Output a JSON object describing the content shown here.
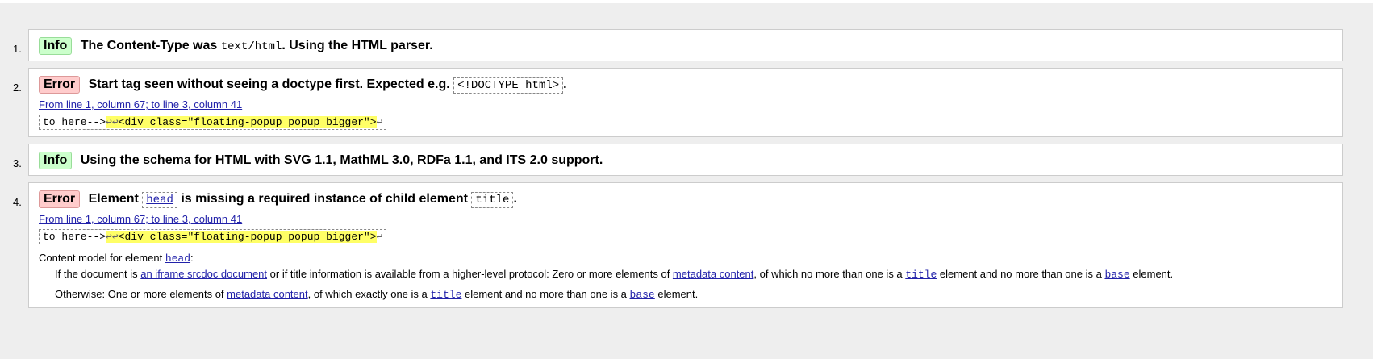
{
  "messages": [
    {
      "num": "1.",
      "badge": "Info",
      "text_before": "The Content-Type was ",
      "code": "text/html",
      "text_after": ". Using the HTML parser."
    },
    {
      "num": "2.",
      "badge": "Error",
      "text_before": "Start tag seen without seeing a doctype first. Expected e.g. ",
      "code": "<!DOCTYPE html>",
      "text_after": ".",
      "location": "From line 1, column 67; to line 3, column 41",
      "extract_pre": "to here-->",
      "extract_lf1": "↩↩",
      "extract_hl": "<div class=\"floating-popup popup bigger\">",
      "extract_lf2": "↩"
    },
    {
      "num": "3.",
      "badge": "Info",
      "text": "Using the schema for HTML with SVG 1.1, MathML 3.0, RDFa 1.1, and ITS 2.0 support."
    },
    {
      "num": "4.",
      "badge": "Error",
      "text_before": "Element ",
      "code1": "head",
      "text_mid": " is missing a required instance of child element ",
      "code2": "title",
      "text_after": ".",
      "location": "From line 1, column 67; to line 3, column 41",
      "extract_pre": "to here-->",
      "extract_lf1": "↩↩",
      "extract_hl": "<div class=\"floating-popup popup bigger\">",
      "extract_lf2": "↩",
      "content_model_label": "Content model for element ",
      "content_model_code": "head",
      "content_model_colon": ":",
      "line1_a": "If the document is ",
      "line1_link": "an iframe srcdoc document",
      "line1_b": " or if title information is available from a higher-level protocol: Zero or more elements of ",
      "line1_link2": "metadata content",
      "line1_c": ", of which no more than one is a ",
      "line1_code1": "title",
      "line1_d": " element and no more than one is a ",
      "line1_code2": "base",
      "line1_e": " element.",
      "line2_a": "Otherwise: One or more elements of ",
      "line2_link": "metadata content",
      "line2_b": ", of which exactly one is a ",
      "line2_code1": "title",
      "line2_c": " element and no more than one is a ",
      "line2_code2": "base",
      "line2_d": " element."
    }
  ],
  "colors": {
    "info_badge": "#ccffcc",
    "error_badge": "#ffcccc",
    "highlight": "#ffff66",
    "link": "#2222aa"
  }
}
